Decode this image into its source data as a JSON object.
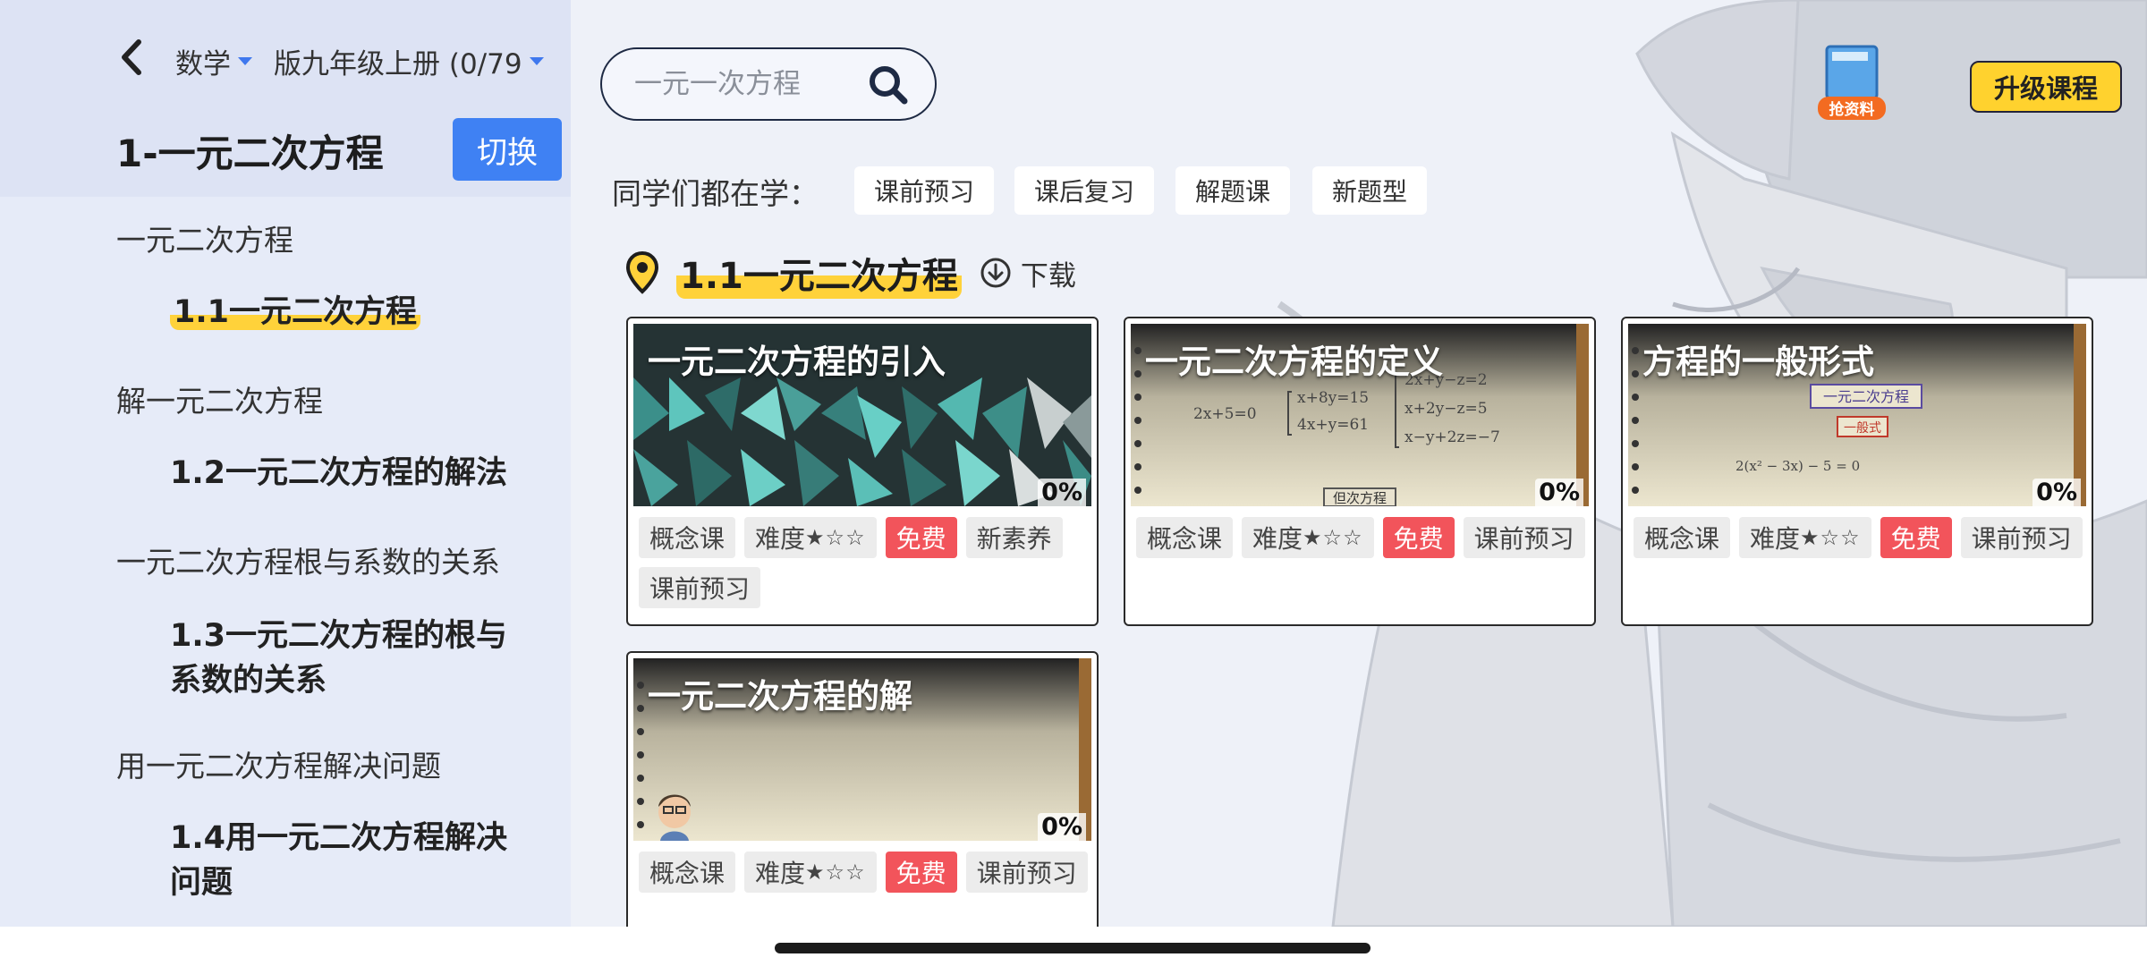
{
  "sidebar": {
    "subject": "数学",
    "book": "版九年级上册 (0/79",
    "chapter_title": "1-一元二次方程",
    "switch_label": "切换",
    "items": [
      {
        "type": "section",
        "label": "一元二次方程"
      },
      {
        "type": "lesson",
        "label": "1.1一元二次方程",
        "active": true
      },
      {
        "type": "section",
        "label": "解一元二次方程"
      },
      {
        "type": "lesson",
        "label": "1.2一元二次方程的解法"
      },
      {
        "type": "section",
        "label": "一元二次方程根与系数的关系"
      },
      {
        "type": "lesson",
        "label_line1": "1.3一元二次方程的根与",
        "label_line2": "系数的关系"
      },
      {
        "type": "section",
        "label": "用一元二次方程解决问题"
      },
      {
        "type": "lesson",
        "label_line1": "1.4用一元二次方程解决",
        "label_line2": "问题"
      }
    ]
  },
  "search": {
    "placeholder": "一元一次方程"
  },
  "promo": {
    "label": "抢资料"
  },
  "upgrade_label": "升级课程",
  "popular": {
    "label": "同学们都在学：",
    "chips": [
      "课前预习",
      "课后复习",
      "解题课",
      "新题型"
    ]
  },
  "lesson_header": {
    "title": "1.1一元二次方程",
    "download_label": "下载"
  },
  "cards": [
    {
      "title": "一元二次方程的引入",
      "progress": "0%",
      "tags": [
        "概念课",
        "难度",
        "免费",
        "新素养",
        "课前预习"
      ],
      "stars": "★☆☆"
    },
    {
      "title": "一元二次方程的定义",
      "progress": "0%",
      "tags": [
        "概念课",
        "难度",
        "免费",
        "课前预习"
      ],
      "stars": "★☆☆",
      "board": {
        "eq1": "2x+5=0",
        "eq2a": "x+8y=15",
        "eq2b": "4x+y=61",
        "eq3a": "2x+y−z=2",
        "eq3b": "x+2y−z=5",
        "eq3c": "x−y+2z=−7",
        "caption": "但次方程"
      }
    },
    {
      "title": "方程的一般形式",
      "progress": "0%",
      "tags": [
        "概念课",
        "难度",
        "免费",
        "课前预习"
      ],
      "stars": "★☆☆",
      "board": {
        "box": "一元二次方程",
        "box2": "一般式",
        "eq": "2(x² − 3x) − 5 = 0"
      }
    },
    {
      "title": "一元二次方程的解",
      "progress": "0%",
      "tags": [
        "概念课",
        "难度",
        "免费",
        "课前预习"
      ],
      "stars": "★☆☆"
    }
  ],
  "colors": {
    "accent": "#3f81f3",
    "highlight": "#ffd23a",
    "free": "#f2545b",
    "upgrade": "#ffd22e"
  }
}
